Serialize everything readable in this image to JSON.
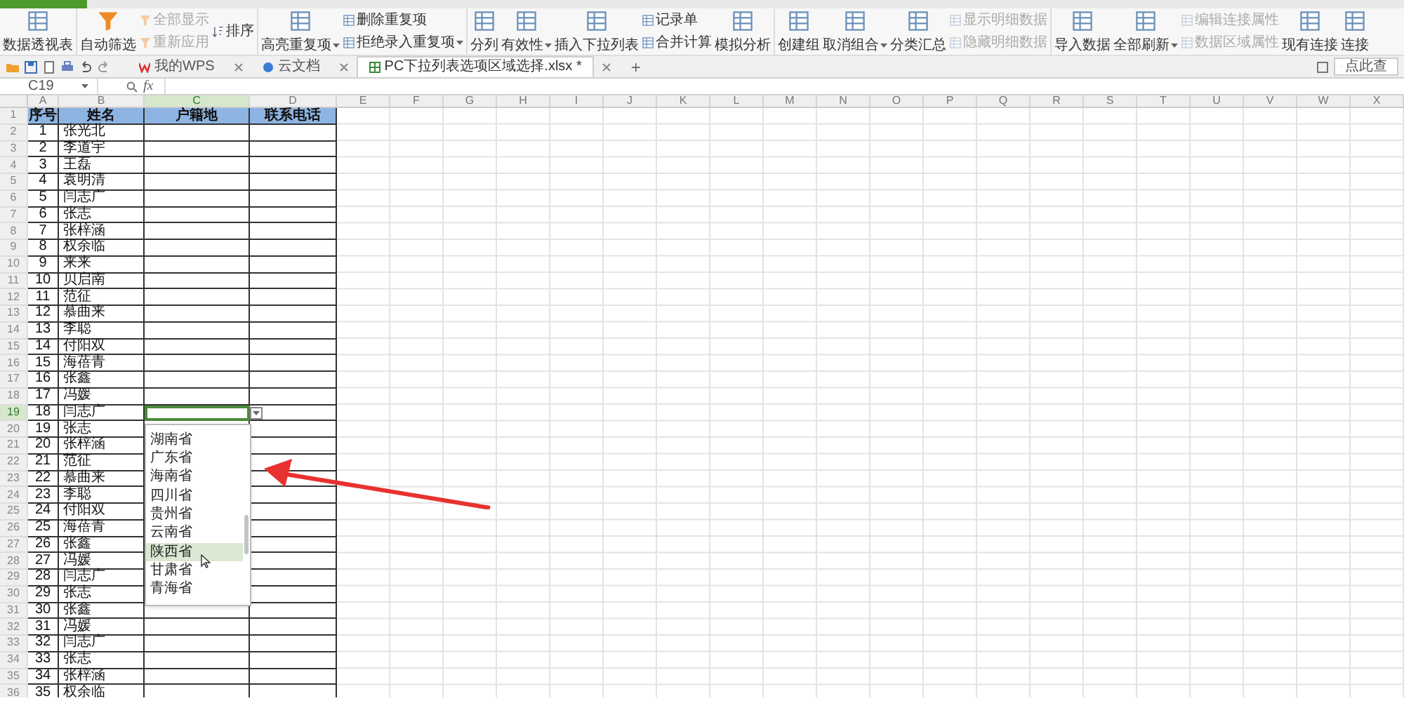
{
  "ribbon": {
    "groups": [
      {
        "items": [
          {
            "label": "数据透视表",
            "kind": "large",
            "disabled": false,
            "menu": false
          }
        ]
      },
      {
        "items": [
          {
            "label": "自动筛选",
            "kind": "large",
            "disabled": false,
            "menu": false
          },
          {
            "label": "全部显示",
            "kind": "small",
            "disabled": true,
            "menu": false
          },
          {
            "label": "重新应用",
            "kind": "small",
            "disabled": true,
            "menu": false
          },
          {
            "label": "排序",
            "kind": "small",
            "disabled": false,
            "menu": false
          }
        ]
      },
      {
        "items": [
          {
            "label": "高亮重复项",
            "kind": "large",
            "disabled": false,
            "menu": true
          },
          {
            "label": "删除重复项",
            "kind": "small",
            "disabled": false,
            "menu": false
          },
          {
            "label": "拒绝录入重复项",
            "kind": "small",
            "disabled": false,
            "menu": true
          }
        ]
      },
      {
        "items": [
          {
            "label": "分列",
            "kind": "large",
            "disabled": false,
            "menu": false
          },
          {
            "label": "有效性",
            "kind": "large",
            "disabled": false,
            "menu": true
          },
          {
            "label": "插入下拉列表",
            "kind": "large",
            "disabled": false,
            "menu": false
          },
          {
            "label": "记录单",
            "kind": "small",
            "disabled": false,
            "menu": false
          },
          {
            "label": "合并计算",
            "kind": "small",
            "disabled": false,
            "menu": false
          },
          {
            "label": "模拟分析",
            "kind": "large",
            "disabled": false,
            "menu": false
          }
        ]
      },
      {
        "items": [
          {
            "label": "创建组",
            "kind": "large",
            "disabled": false,
            "menu": false
          },
          {
            "label": "取消组合",
            "kind": "large",
            "disabled": false,
            "menu": true
          },
          {
            "label": "分类汇总",
            "kind": "large",
            "disabled": false,
            "menu": false
          },
          {
            "label": "显示明细数据",
            "kind": "small",
            "disabled": true,
            "menu": false
          },
          {
            "label": "隐藏明细数据",
            "kind": "small",
            "disabled": true,
            "menu": false
          }
        ]
      },
      {
        "items": [
          {
            "label": "导入数据",
            "kind": "large",
            "disabled": false,
            "menu": false
          },
          {
            "label": "全部刷新",
            "kind": "large",
            "disabled": false,
            "menu": true
          },
          {
            "label": "编辑连接属性",
            "kind": "small",
            "disabled": true,
            "menu": false
          },
          {
            "label": "数据区域属性",
            "kind": "small",
            "disabled": true,
            "menu": false
          },
          {
            "label": "现有连接",
            "kind": "large",
            "disabled": false,
            "menu": false
          },
          {
            "label": "连接",
            "kind": "large",
            "disabled": false,
            "menu": false
          }
        ]
      }
    ]
  },
  "doc_tabs": [
    {
      "label": "我的WPS",
      "selected": false
    },
    {
      "label": "云文档",
      "selected": false
    },
    {
      "label": "PC下拉列表选项区域选择.xlsx *",
      "selected": true
    }
  ],
  "new_tab": "+",
  "search": {
    "placeholder": "点此查"
  },
  "formula_bar": {
    "name_box": "C19",
    "fx": "fx"
  },
  "sheet": {
    "column_letters": [
      {
        "label": "A",
        "selected": false
      },
      {
        "label": "B",
        "selected": false
      },
      {
        "label": "C",
        "selected": true
      },
      {
        "label": "D",
        "selected": false
      },
      {
        "label": "E",
        "selected": false
      },
      {
        "label": "F",
        "selected": false
      },
      {
        "label": "G",
        "selected": false
      },
      {
        "label": "H",
        "selected": false
      },
      {
        "label": "I",
        "selected": false
      },
      {
        "label": "J",
        "selected": false
      },
      {
        "label": "K",
        "selected": false
      },
      {
        "label": "L",
        "selected": false
      },
      {
        "label": "M",
        "selected": false
      },
      {
        "label": "N",
        "selected": false
      },
      {
        "label": "O",
        "selected": false
      },
      {
        "label": "P",
        "selected": false
      },
      {
        "label": "Q",
        "selected": false
      },
      {
        "label": "R",
        "selected": false
      },
      {
        "label": "S",
        "selected": false
      },
      {
        "label": "T",
        "selected": false
      },
      {
        "label": "U",
        "selected": false
      },
      {
        "label": "V",
        "selected": false
      },
      {
        "label": "W",
        "selected": false
      },
      {
        "label": "X",
        "selected": false
      }
    ],
    "header": [
      "序号",
      "姓名",
      "户籍地",
      "联系电话"
    ],
    "rows": [
      {
        "no": "1",
        "name": "张光北",
        "active": false
      },
      {
        "no": "2",
        "name": "李道宇",
        "active": false
      },
      {
        "no": "3",
        "name": "王磊",
        "active": false
      },
      {
        "no": "4",
        "name": "袁明清",
        "active": false
      },
      {
        "no": "5",
        "name": "闫志广",
        "active": false
      },
      {
        "no": "6",
        "name": "张志",
        "active": false
      },
      {
        "no": "7",
        "name": "张梓涵",
        "active": false
      },
      {
        "no": "8",
        "name": "权余临",
        "active": false
      },
      {
        "no": "9",
        "name": "来来",
        "active": false
      },
      {
        "no": "10",
        "name": "贝启南",
        "active": false
      },
      {
        "no": "11",
        "name": "范征",
        "active": false
      },
      {
        "no": "12",
        "name": "慕曲来",
        "active": false
      },
      {
        "no": "13",
        "name": "李聪",
        "active": false
      },
      {
        "no": "14",
        "name": "付阳双",
        "active": false
      },
      {
        "no": "15",
        "name": "海蓓青",
        "active": false
      },
      {
        "no": "16",
        "name": "张鑫",
        "active": false
      },
      {
        "no": "17",
        "name": "冯媛",
        "active": false
      },
      {
        "no": "18",
        "name": "闫志广",
        "active": true
      },
      {
        "no": "19",
        "name": "张志",
        "active": false
      },
      {
        "no": "20",
        "name": "张梓涵",
        "active": false
      },
      {
        "no": "21",
        "name": "范征",
        "active": false
      },
      {
        "no": "22",
        "name": "慕曲来",
        "active": false
      },
      {
        "no": "23",
        "name": "李聪",
        "active": false
      },
      {
        "no": "24",
        "name": "付阳双",
        "active": false
      },
      {
        "no": "25",
        "name": "海蓓青",
        "active": false
      },
      {
        "no": "26",
        "name": "张鑫",
        "active": false
      },
      {
        "no": "27",
        "name": "冯媛",
        "active": false
      },
      {
        "no": "28",
        "name": "闫志广",
        "active": false
      },
      {
        "no": "29",
        "name": "张志",
        "active": false
      },
      {
        "no": "30",
        "name": "张鑫",
        "active": false
      },
      {
        "no": "31",
        "name": "冯媛",
        "active": false
      },
      {
        "no": "32",
        "name": "闫志广",
        "active": false
      },
      {
        "no": "33",
        "name": "张志",
        "active": false
      },
      {
        "no": "34",
        "name": "张梓涵",
        "active": false
      },
      {
        "no": "35",
        "name": "权余临",
        "active": false
      }
    ],
    "row_numbers": [
      {
        "label": "1",
        "selected": false
      },
      {
        "label": "2",
        "selected": false
      },
      {
        "label": "3",
        "selected": false
      },
      {
        "label": "4",
        "selected": false
      },
      {
        "label": "5",
        "selected": false
      },
      {
        "label": "6",
        "selected": false
      },
      {
        "label": "7",
        "selected": false
      },
      {
        "label": "8",
        "selected": false
      },
      {
        "label": "9",
        "selected": false
      },
      {
        "label": "10",
        "selected": false
      },
      {
        "label": "11",
        "selected": false
      },
      {
        "label": "12",
        "selected": false
      },
      {
        "label": "13",
        "selected": false
      },
      {
        "label": "14",
        "selected": false
      },
      {
        "label": "15",
        "selected": false
      },
      {
        "label": "16",
        "selected": false
      },
      {
        "label": "17",
        "selected": false
      },
      {
        "label": "18",
        "selected": false
      },
      {
        "label": "19",
        "selected": true
      },
      {
        "label": "20",
        "selected": false
      },
      {
        "label": "21",
        "selected": false
      },
      {
        "label": "22",
        "selected": false
      },
      {
        "label": "23",
        "selected": false
      },
      {
        "label": "24",
        "selected": false
      },
      {
        "label": "25",
        "selected": false
      },
      {
        "label": "26",
        "selected": false
      },
      {
        "label": "27",
        "selected": false
      },
      {
        "label": "28",
        "selected": false
      },
      {
        "label": "29",
        "selected": false
      },
      {
        "label": "30",
        "selected": false
      },
      {
        "label": "31",
        "selected": false
      },
      {
        "label": "32",
        "selected": false
      },
      {
        "label": "33",
        "selected": false
      },
      {
        "label": "34",
        "selected": false
      },
      {
        "label": "35",
        "selected": false
      },
      {
        "label": "36",
        "selected": false
      }
    ]
  },
  "dropdown": {
    "items": [
      {
        "label": "湖南省",
        "selected": false
      },
      {
        "label": "广东省",
        "selected": false
      },
      {
        "label": "海南省",
        "selected": false
      },
      {
        "label": "四川省",
        "selected": false
      },
      {
        "label": "贵州省",
        "selected": false
      },
      {
        "label": "云南省",
        "selected": false
      },
      {
        "label": "陕西省",
        "selected": true
      },
      {
        "label": "甘肃省",
        "selected": false
      },
      {
        "label": "青海省",
        "selected": false
      }
    ]
  }
}
